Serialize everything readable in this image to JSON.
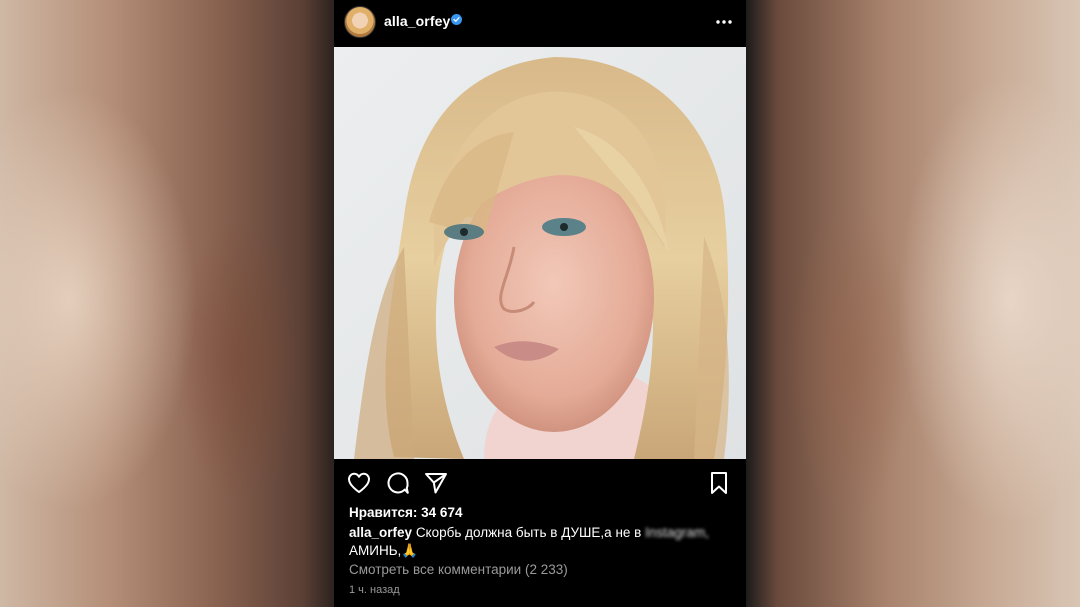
{
  "post": {
    "username": "alla_orfey",
    "likes_text": "Нравится: 34 674",
    "caption_user": "alla_orfey",
    "caption_text": "Скорбь должна быть в ДУШЕ,а не в ",
    "caption_blurred": "Instagram,",
    "caption_line2": "АМИНЬ,",
    "caption_emoji": "🙏",
    "view_comments": "Смотреть все комментарии (2 233)",
    "time_ago": "1 ч. назад"
  },
  "icons": {
    "verified": "verified-badge-icon",
    "more": "more-options-icon",
    "like": "heart-icon",
    "comment": "comment-icon",
    "share": "share-icon",
    "save": "bookmark-icon"
  },
  "colors": {
    "background": "#000000",
    "verified": "#3897f0",
    "muted_text": "#9a9a9a"
  }
}
